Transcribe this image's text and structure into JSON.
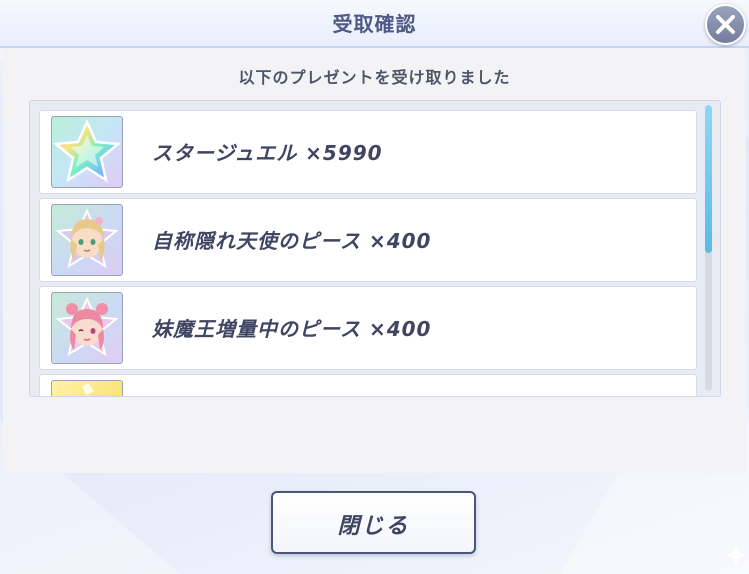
{
  "dialog": {
    "title": "受取確認",
    "subtitle": "以下のプレゼントを受け取りました",
    "close_button_label": "閉じる"
  },
  "items": [
    {
      "label": "スタージュエル ×5990",
      "icon": "star-jewel-icon"
    },
    {
      "label": "自称隠れ天使のピース ×400",
      "icon": "character-piece-icon"
    },
    {
      "label": "妹魔王増量中のピース ×400",
      "icon": "character-piece-icon"
    },
    {
      "label": "",
      "icon": "item-icon"
    }
  ],
  "colors": {
    "accent": "#4e5a86",
    "scrollbar": "#5bb9ea",
    "panel": "#f3f3f5"
  }
}
